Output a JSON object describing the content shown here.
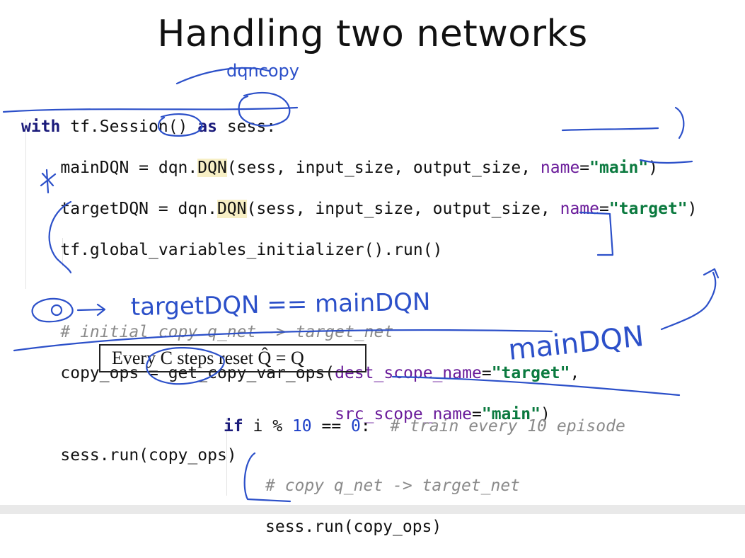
{
  "slide": {
    "title": "Handling two networks"
  },
  "code_block_1": {
    "line1": {
      "kw_with": "with",
      "text_a": " tf.Session() ",
      "kw_as": "as",
      "text_b": " sess:"
    },
    "line2": {
      "prefix": "    mainDQN = dqn.",
      "fn": "DQN",
      "args": "(sess, input_size, output_size, ",
      "kwarg": "name",
      "eq": "=",
      "str": "\"main\"",
      "close": ")"
    },
    "line3": {
      "prefix": "    targetDQN = dqn.",
      "fn": "DQN",
      "args": "(sess, input_size, output_size, ",
      "kwarg": "name",
      "eq": "=",
      "str": "\"target\"",
      "close": ")"
    },
    "line4": "    tf.global_variables_initializer().run()",
    "line5": "    # initial copy q_net -> target_net",
    "line6": {
      "prefix": "    copy_ops = get_copy_var_ops(",
      "kwarg": "dest_scope_name",
      "eq": "=",
      "str": "\"target\"",
      "close": ","
    },
    "line7": {
      "indent": "                                ",
      "kwarg": "src_scope_name",
      "eq": "=",
      "str": "\"main\"",
      "close": ")"
    },
    "line8": "    sess.run(copy_ops)"
  },
  "formula": {
    "text": "Every C steps reset Q̂ = Q"
  },
  "code_block_2": {
    "line1": {
      "kw_if": "if",
      "text_a": " i % ",
      "num1": "10",
      "text_b": " == ",
      "num2": "0",
      "text_c": ":  ",
      "comment": "# train every 10 episode"
    },
    "line2": "# copy q_net -> target_net",
    "line3": "sess.run(copy_ops)"
  },
  "annotations": {
    "note_dqncopy": "dqncopy",
    "note_equality": "targetDQN == mainDQN",
    "note_maindqn": "mainDQN",
    "ink_color": "#2c50c9"
  }
}
